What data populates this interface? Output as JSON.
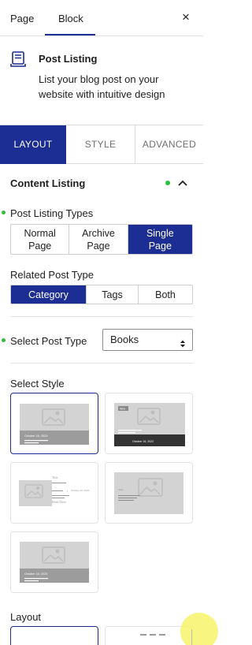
{
  "top_tabs": {
    "page": "Page",
    "block": "Block",
    "close": "×"
  },
  "block": {
    "title": "Post Listing",
    "description": "List your blog post on your website with intuitive design"
  },
  "panel_tabs": {
    "layout": "LAYOUT",
    "style": "STYLE",
    "advanced": "ADVANCED"
  },
  "section": {
    "title": "Content Listing"
  },
  "post_listing_types": {
    "label": "Post Listing Types",
    "options": [
      "Normal Page",
      "Archive Page",
      "Single Page"
    ],
    "selected": "Single Page"
  },
  "related_post_type": {
    "label": "Related Post Type",
    "options": [
      "Category",
      "Tags",
      "Both"
    ],
    "selected": "Category"
  },
  "select_post_type": {
    "label": "Select Post Type",
    "value": "Books"
  },
  "select_style": {
    "label": "Select Style"
  },
  "layout": {
    "label": "Layout"
  },
  "thumb_text": {
    "date": "October 16, 2023",
    "date_short": "October 16, 2022",
    "badge": "New",
    "title": "Title",
    "read_more": "Read More"
  },
  "colors": {
    "accent": "#1c2d93",
    "indicator": "#2fbe3a"
  }
}
